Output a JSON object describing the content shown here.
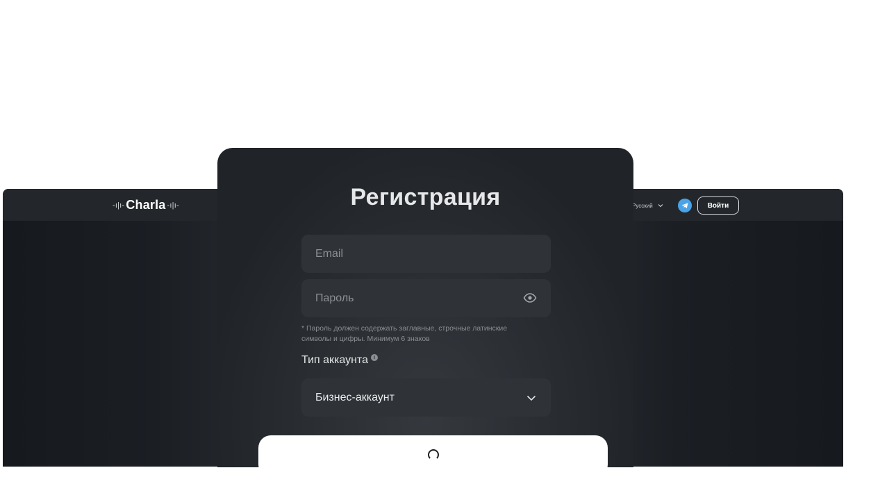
{
  "header": {
    "logo_text": "Charla",
    "language": "Русский",
    "login_label": "Войти"
  },
  "form": {
    "title": "Регистрация",
    "email_placeholder": "Email",
    "password_placeholder": "Пароль",
    "password_hint": "* Пароль должен содержать заглавные, строчные латинские символы и цифры. Минимум 6 знаков",
    "account_type_label": "Тип аккаунта",
    "account_type_value": "Бизнес-аккаунт"
  },
  "colors": {
    "card_bg": "#202428",
    "field_bg": "#2f3338",
    "telegram": "#4aa3e6",
    "submit_bg": "#ffffff"
  },
  "icons": [
    "eye-icon",
    "chevron-down-icon",
    "info-icon",
    "telegram-icon",
    "language-chevron-icon",
    "loading-icon"
  ]
}
